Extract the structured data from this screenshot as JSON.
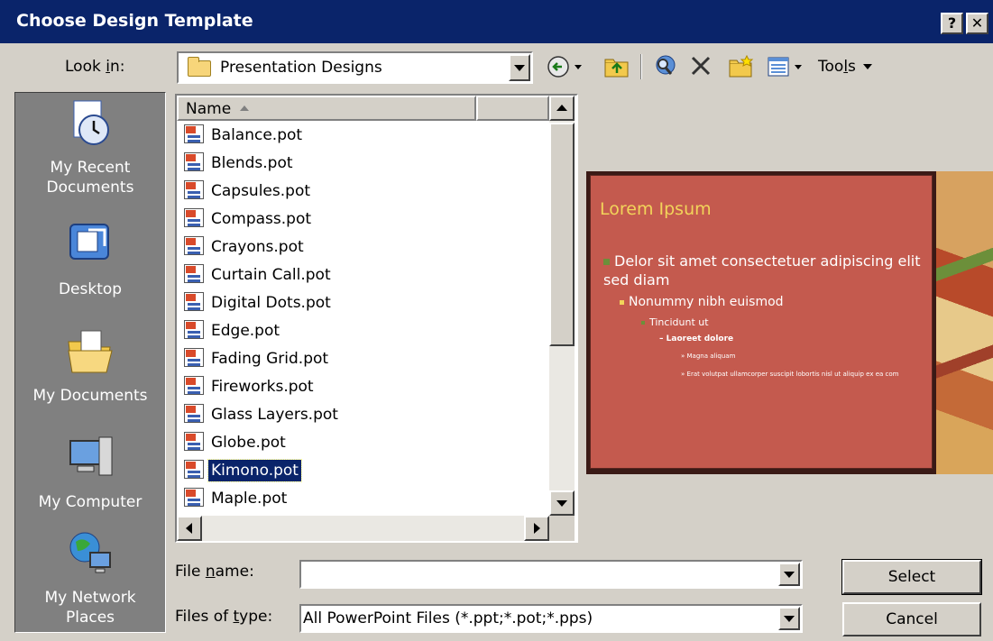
{
  "window": {
    "title": "Choose Design Template",
    "help_label": "?",
    "close_label": "✕"
  },
  "lookin": {
    "label_pre": "Look ",
    "label_key": "i",
    "label_post": "n:",
    "value": "Presentation Designs"
  },
  "toolbar": {
    "tools_pre": "Too",
    "tools_key": "l",
    "tools_post": "s"
  },
  "places": [
    {
      "label": "My Recent Documents",
      "line1": "My Recent",
      "line2": "Documents",
      "icon": "recent-documents-icon"
    },
    {
      "label": "Desktop",
      "line1": "Desktop",
      "line2": "",
      "icon": "desktop-icon"
    },
    {
      "label": "My Documents",
      "line1": "My Documents",
      "line2": "",
      "icon": "my-documents-icon"
    },
    {
      "label": "My Computer",
      "line1": "My Computer",
      "line2": "",
      "icon": "my-computer-icon"
    },
    {
      "label": "My Network Places",
      "line1": "My Network",
      "line2": "Places",
      "icon": "network-places-icon"
    }
  ],
  "filelist": {
    "column_name": "Name",
    "files": [
      "Balance.pot",
      "Blends.pot",
      "Capsules.pot",
      "Compass.pot",
      "Crayons.pot",
      "Curtain Call.pot",
      "Digital Dots.pot",
      "Edge.pot",
      "Fading Grid.pot",
      "Fireworks.pot",
      "Glass Layers.pot",
      "Globe.pot",
      "Kimono.pot",
      "Maple.pot"
    ],
    "selected": "Kimono.pot"
  },
  "preview": {
    "title": "Lorem Ipsum",
    "bullet1": "Delor sit amet consectetuer adipiscing elit sed diam",
    "bullet2": "Nonummy nibh euismod",
    "bullet3": "Tincidunt ut",
    "bullet4": "Laoreet dolore",
    "bullet5": "Magna aliquam",
    "bullet6": "Erat volutpat ullamcorper suscipit lobortis nisl ut aliquip ex ea com",
    "footer_left": "",
    "footer_mid": "",
    "colors": {
      "slide_bg": "#c45a4e",
      "title": "#f2d45a",
      "bullet": "#6c8f3a"
    }
  },
  "filename": {
    "label_pre": "File ",
    "label_key": "n",
    "label_post": "ame:",
    "value": ""
  },
  "filetype": {
    "label_pre": "Files of ",
    "label_key": "t",
    "label_post": "ype:",
    "value": "All PowerPoint Files (*.ppt;*.pot;*.pps)"
  },
  "buttons": {
    "select": "Select",
    "cancel": "Cancel"
  }
}
